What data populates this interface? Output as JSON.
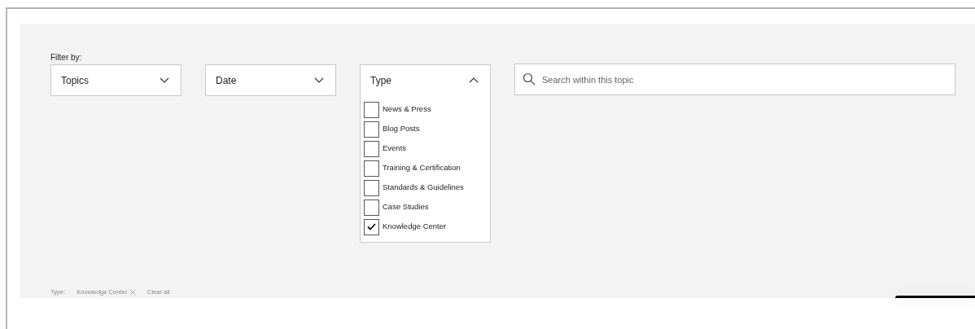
{
  "filter_label": "Filter by:",
  "dropdowns": [
    {
      "label": "Topics",
      "expanded": false
    },
    {
      "label": "Date",
      "expanded": false
    },
    {
      "label": "Type",
      "expanded": true,
      "options": [
        {
          "label": "News & Press",
          "checked": false
        },
        {
          "label": "Blog Posts",
          "checked": false
        },
        {
          "label": "Events",
          "checked": false
        },
        {
          "label": "Training & Certification",
          "checked": false
        },
        {
          "label": "Standards & Guidelines",
          "checked": false
        },
        {
          "label": "Case Studies",
          "checked": false
        },
        {
          "label": "Knowledge Center",
          "checked": true
        }
      ]
    }
  ],
  "search": {
    "placeholder": "Search within this topic"
  },
  "active_filters": {
    "label": "Type:",
    "chips": [
      "Knowledge Center"
    ],
    "clear": "Clear all"
  }
}
